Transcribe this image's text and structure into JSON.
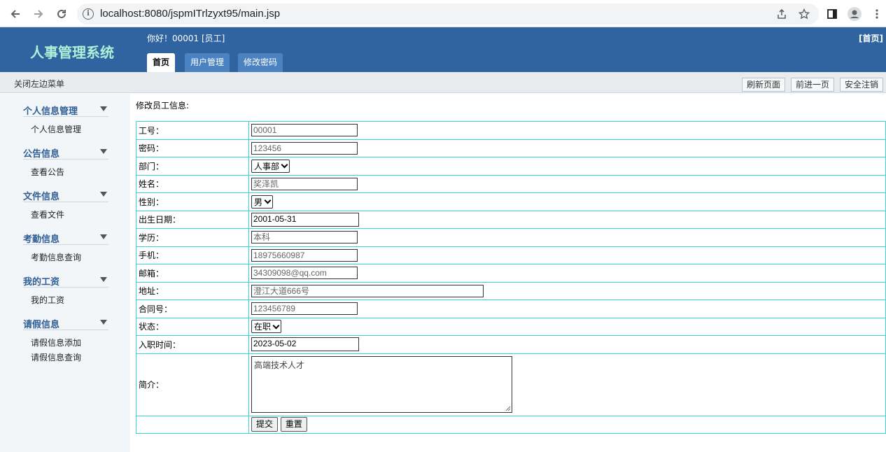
{
  "browser": {
    "url": "localhost:8080/jspmITrlzyxt95/main.jsp"
  },
  "header": {
    "logo": "人事管理系统",
    "greeting": "你好！00001 [员工]",
    "home_link": "[首页]",
    "tabs": [
      "首页",
      "用户管理",
      "修改密码"
    ]
  },
  "toolbar": {
    "close_menu": "关闭左边菜单",
    "refresh": "刷新页面",
    "forward": "前进一页",
    "logout": "安全注销"
  },
  "sidebar": {
    "groups": [
      {
        "title": "个人信息管理",
        "items": [
          "个人信息管理"
        ]
      },
      {
        "title": "公告信息",
        "items": [
          "查看公告"
        ]
      },
      {
        "title": "文件信息",
        "items": [
          "查看文件"
        ]
      },
      {
        "title": "考勤信息",
        "items": [
          "考勤信息查询"
        ]
      },
      {
        "title": "我的工资",
        "items": [
          "我的工资"
        ]
      },
      {
        "title": "请假信息",
        "items": [
          "请假信息添加",
          "请假信息查询"
        ]
      }
    ]
  },
  "form": {
    "title": "修改员工信息:",
    "fields": {
      "emp_id": {
        "label": "工号：",
        "value": "00001"
      },
      "password": {
        "label": "密码：",
        "value": "123456"
      },
      "department": {
        "label": "部门：",
        "value": "人事部"
      },
      "name": {
        "label": "姓名：",
        "value": "奖泽凯"
      },
      "gender": {
        "label": "性别：",
        "value": "男"
      },
      "birth": {
        "label": "出生日期：",
        "value": "2001-05-31"
      },
      "education": {
        "label": "学历：",
        "value": "本科"
      },
      "phone": {
        "label": "手机：",
        "value": "18975660987"
      },
      "email": {
        "label": "邮箱：",
        "value": "34309098@qq.com"
      },
      "address": {
        "label": "地址：",
        "value": "澄江大道666号"
      },
      "contract": {
        "label": "合同号：",
        "value": "123456789"
      },
      "status": {
        "label": "状态：",
        "value": "在职"
      },
      "hire_date": {
        "label": "入职时间：",
        "value": "2023-05-02"
      },
      "intro": {
        "label": "简介：",
        "value": "高端技术人才"
      }
    },
    "submit": "提交",
    "reset": "重置"
  }
}
